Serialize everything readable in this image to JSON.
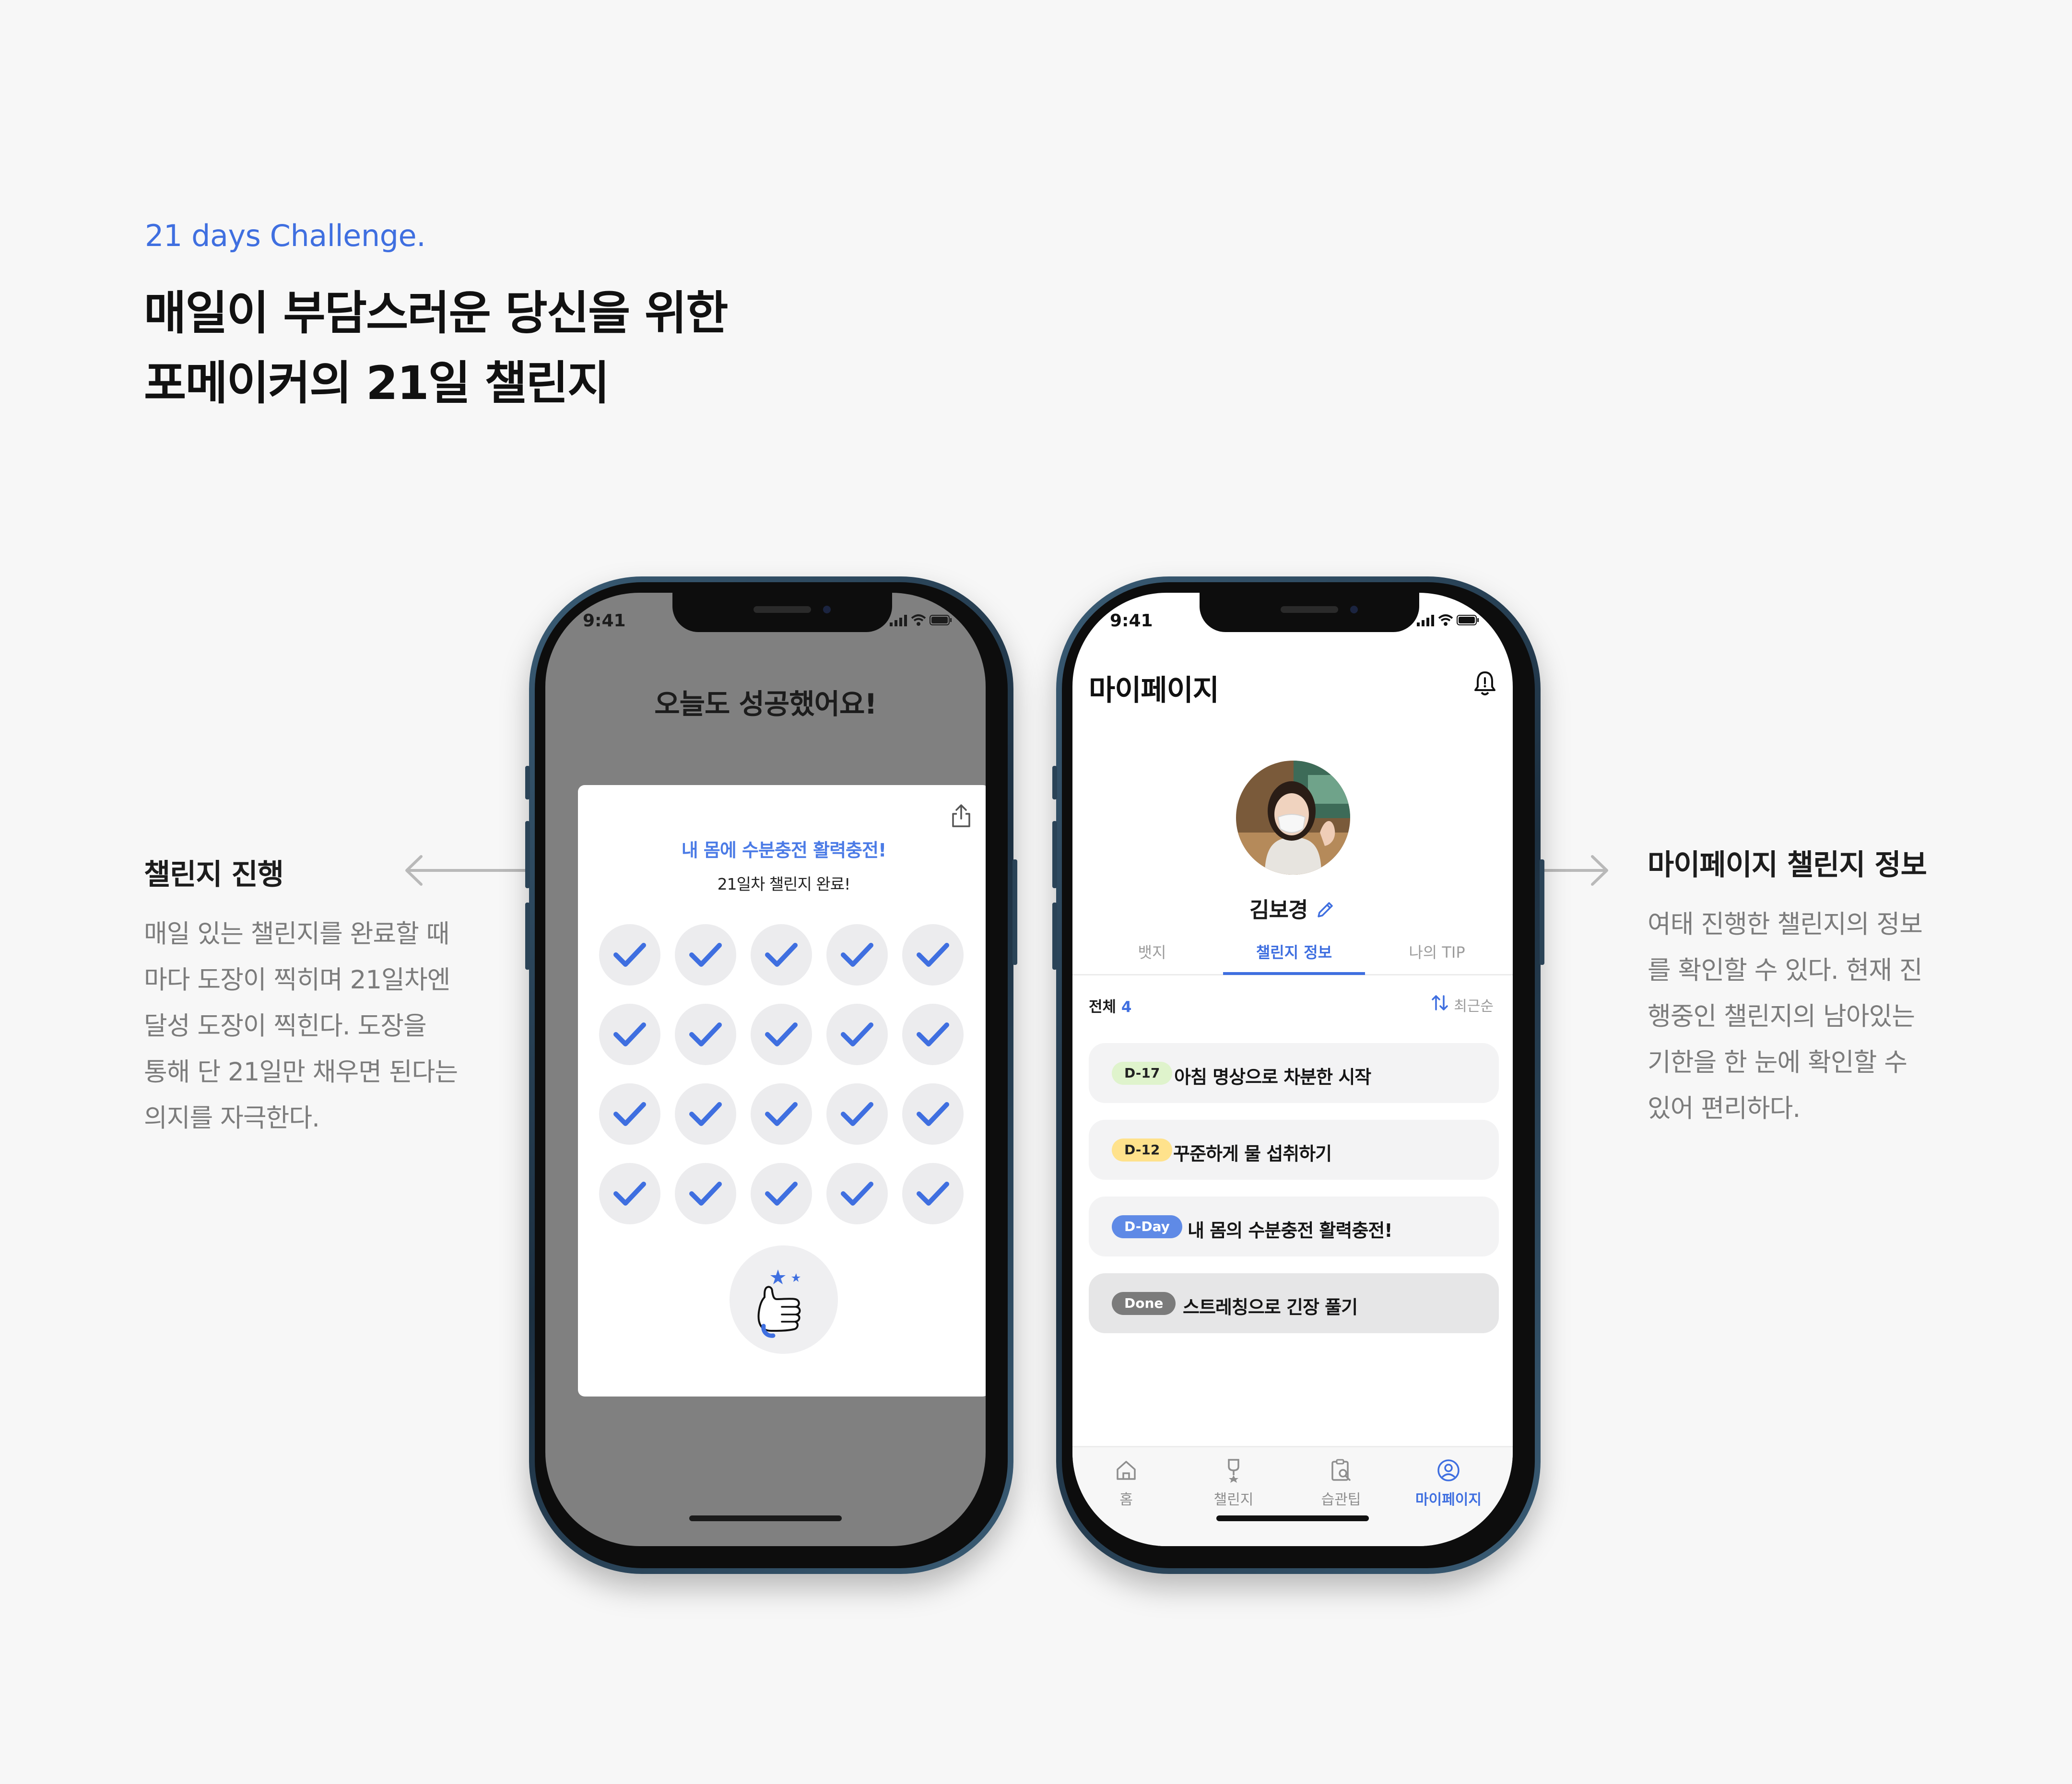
{
  "header": {
    "kicker": "21 days Challenge.",
    "headline_lines": [
      "매일이 부담스러운 당신을 위한",
      "포메이커의 21일 챌린지"
    ]
  },
  "left_description": {
    "title": "챌린지 진행",
    "body_lines": [
      "매일 있는 챌린지를 완료할 때",
      "마다 도장이 찍히며 21일차엔",
      "달성 도장이 찍힌다. 도장을",
      "통해 단 21일만 채우면 된다는",
      "의지를 자극한다."
    ]
  },
  "right_description": {
    "title": "마이페이지 챌린지 정보",
    "body_lines": [
      "여태 진행한 챌린지의 정보",
      "를 확인할 수 있다. 현재 진",
      "행중인 챌린지의 남아있는",
      "기한을 한 눈에 확인할 수",
      "있어 편리하다."
    ]
  },
  "phone_left": {
    "status_time": "9:41",
    "title": "오늘도 성공했어요!",
    "card": {
      "challenge_name": "내 몸에 수분충전 활력충전!",
      "subtitle": "21일차  챌린지 완료!",
      "share_icon": "share-icon",
      "stamps_completed": 20,
      "stamp_icon": "check-icon",
      "badge_icon": "thumbs-up-icon"
    }
  },
  "phone_right": {
    "status_time": "9:41",
    "title": "마이페이지",
    "bell_icon": "bell-icon",
    "profile": {
      "name": "김보경",
      "edit_icon": "pencil-icon"
    },
    "tabs": [
      {
        "label": "뱃지",
        "active": false
      },
      {
        "label": "챌린지 정보",
        "active": true
      },
      {
        "label": "나의 TIP",
        "active": false
      }
    ],
    "list_header": {
      "label": "전체",
      "count": "4",
      "sort_label": "최근순",
      "sort_icon": "sort-icon"
    },
    "challenges": [
      {
        "badge": "D-17",
        "title": "아침 명상으로 차분한 시작",
        "badge_bg": "#dff3cc",
        "badge_fg": "#222222"
      },
      {
        "badge": "D-12",
        "title": "꾸준하게 물 섭취하기",
        "badge_bg": "#ffe28c",
        "badge_fg": "#222222"
      },
      {
        "badge": "D-Day",
        "title": "내 몸의 수분충전 활력충전!",
        "badge_bg": "#5f8ae6",
        "badge_fg": "#ffffff"
      },
      {
        "badge": "Done",
        "title": "스트레칭으로 긴장 풀기",
        "badge_bg": "#7b7b7b",
        "badge_fg": "#ffffff"
      }
    ],
    "tabbar": [
      {
        "label": "홈",
        "icon": "home-icon",
        "active": false
      },
      {
        "label": "챌린지",
        "icon": "medal-icon",
        "active": false
      },
      {
        "label": "습관팁",
        "icon": "clipboard-search-icon",
        "active": false
      },
      {
        "label": "마이페이지",
        "icon": "user-icon",
        "active": true
      }
    ]
  },
  "colors": {
    "accent": "#3f6fe0",
    "background": "#f7f7f7",
    "overlay": "#808080"
  }
}
